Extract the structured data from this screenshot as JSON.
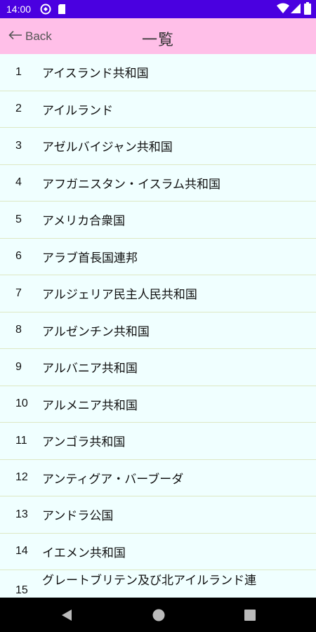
{
  "status_bar": {
    "time": "14:00",
    "icons": [
      "sync-icon",
      "sim-card-icon",
      "wifi-icon",
      "signal-icon",
      "battery-icon"
    ]
  },
  "app_bar": {
    "back_label": "Back",
    "title": "一覧"
  },
  "list": {
    "items": [
      {
        "num": "1",
        "name": "アイスランド共和国"
      },
      {
        "num": "2",
        "name": "アイルランド"
      },
      {
        "num": "3",
        "name": "アゼルバイジャン共和国"
      },
      {
        "num": "4",
        "name": "アフガニスタン・イスラム共和国"
      },
      {
        "num": "5",
        "name": "アメリカ合衆国"
      },
      {
        "num": "6",
        "name": "アラブ首長国連邦"
      },
      {
        "num": "7",
        "name": "アルジェリア民主人民共和国"
      },
      {
        "num": "8",
        "name": "アルゼンチン共和国"
      },
      {
        "num": "9",
        "name": "アルバニア共和国"
      },
      {
        "num": "10",
        "name": "アルメニア共和国"
      },
      {
        "num": "11",
        "name": "アンゴラ共和国"
      },
      {
        "num": "12",
        "name": "アンティグア・バーブーダ"
      },
      {
        "num": "13",
        "name": "アンドラ公国"
      },
      {
        "num": "14",
        "name": "イエメン共和国"
      },
      {
        "num": "15",
        "name": "グレートブリテン及び北アイルランド連"
      }
    ]
  },
  "nav_bar": {
    "buttons": [
      "back-triangle-icon",
      "home-circle-icon",
      "recents-square-icon"
    ]
  },
  "colors": {
    "status_bar": "#4a00e0",
    "app_bar": "#ffbfe8",
    "list_background": "#f0ffff",
    "divider": "#dde8c4"
  }
}
